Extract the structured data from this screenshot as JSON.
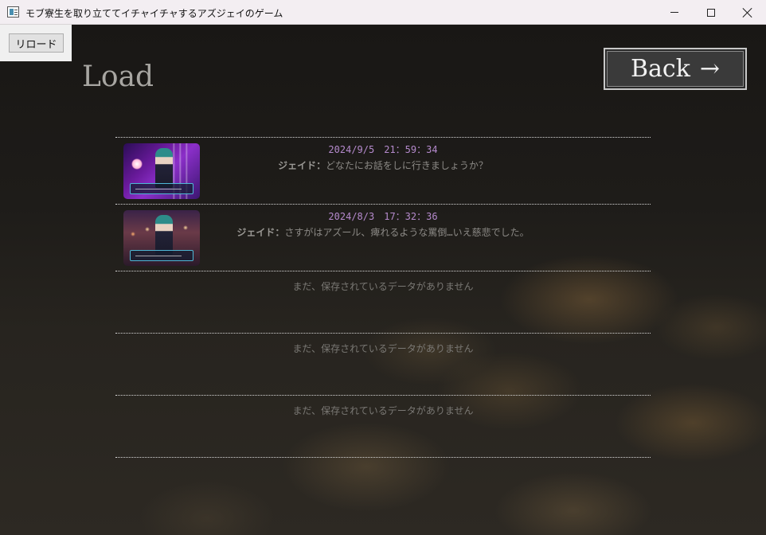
{
  "window": {
    "title": "モブ寮生を取り立ててイチャイチャするアズジェイのゲーム",
    "minimize": "minimize",
    "maximize": "maximize",
    "close": "close"
  },
  "toolbar": {
    "reload_label": "リロード"
  },
  "screen": {
    "heading": "Load",
    "back_label": "Back",
    "back_arrow": "→"
  },
  "slots": [
    {
      "state": "filled",
      "date": "2024/9/5　21：59：34",
      "speaker": "ジェイド：",
      "line": "どなたにお話をしに行きましょうか？"
    },
    {
      "state": "filled",
      "date": "2024/8/3　17：32：36",
      "speaker": "ジェイド：",
      "line": "さすがはアズール、痺れるような罵倒…いえ慈悲でした。"
    },
    {
      "state": "empty",
      "empty_text": "まだ、保存されているデータがありません"
    },
    {
      "state": "empty",
      "empty_text": "まだ、保存されているデータがありません"
    },
    {
      "state": "empty",
      "empty_text": "まだ、保存されているデータがありません"
    }
  ],
  "colors": {
    "date_text": "#b58acd",
    "line_text": "#8c8a86",
    "heading_text": "#a8a6a2"
  }
}
